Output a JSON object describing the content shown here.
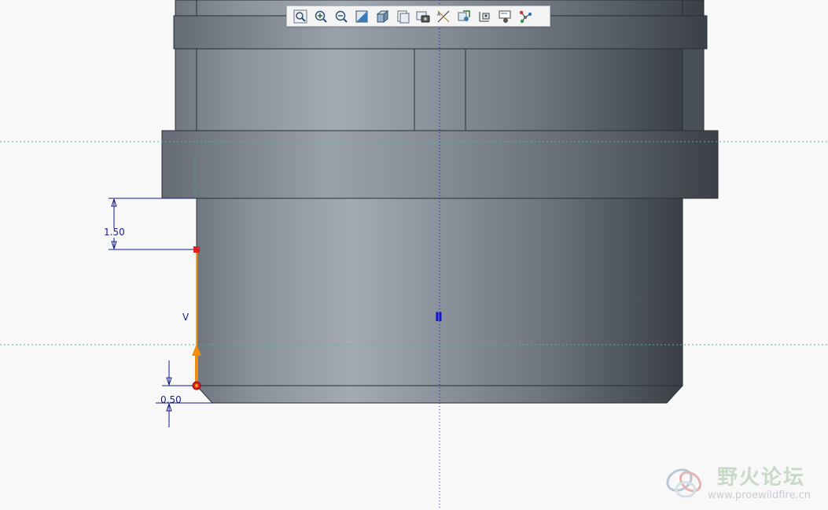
{
  "toolbar": {
    "buttons": [
      {
        "name": "refit-button",
        "icon": "refit-icon"
      },
      {
        "name": "zoom-in-button",
        "icon": "zoom-in-icon"
      },
      {
        "name": "zoom-out-button",
        "icon": "zoom-out-icon"
      },
      {
        "name": "repaint-button",
        "icon": "repaint-icon"
      },
      {
        "name": "display-style-button",
        "icon": "display-style-icon"
      },
      {
        "name": "saved-orientations-button",
        "icon": "saved-views-icon"
      },
      {
        "name": "view-manager-button",
        "icon": "view-manager-icon"
      },
      {
        "name": "datum-display-button",
        "icon": "datum-display-icon"
      },
      {
        "name": "annotation-display-button",
        "icon": "annotation-display-icon"
      },
      {
        "name": "sketch-display-button",
        "icon": "sketch-display-icon"
      },
      {
        "name": "sketch-view-button",
        "icon": "sketch-view-icon"
      },
      {
        "name": "relations-button",
        "icon": "relations-icon"
      }
    ]
  },
  "sketch": {
    "dim_upper": "1.50",
    "dim_lower": "0.50",
    "constraint_vertical": "V",
    "constraint_symmetry": "II"
  },
  "watermark": {
    "title": "野火论坛",
    "url": "www.proewildfire.cn"
  },
  "colors": {
    "background": "#f8f8f8",
    "dimension": "#1a1a8a",
    "sketch_entity": "#f0a020",
    "selected_point": "#e02020",
    "centerline": "#1a1a8a",
    "reference_line": "#40b8b0"
  }
}
